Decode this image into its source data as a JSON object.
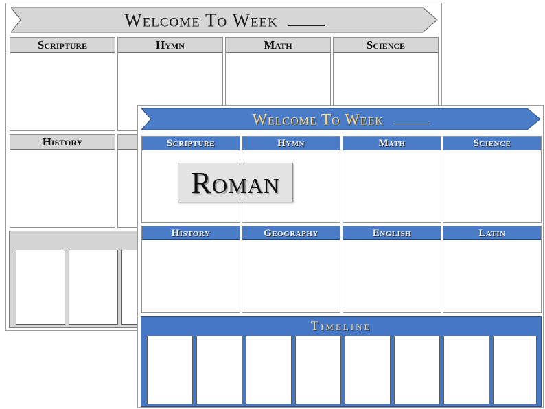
{
  "gray_sheet": {
    "banner_title": "Welcome To Week",
    "subjects_row1": [
      "Scripture",
      "Hymn",
      "Math",
      "Science"
    ],
    "subjects_row2": [
      "History"
    ]
  },
  "blue_sheet": {
    "banner_title": "Welcome To Week",
    "subjects_row1": [
      "Scripture",
      "Hymn",
      "Math",
      "Science"
    ],
    "subjects_row2": [
      "History",
      "Geography",
      "English",
      "Latin"
    ],
    "timeline_title": "Timeline",
    "era_label": "Roman"
  },
  "colors": {
    "accent_blue": "#4a7cc8",
    "header_gray": "#d6d6d6",
    "title_gold": "#e9d9a9"
  }
}
